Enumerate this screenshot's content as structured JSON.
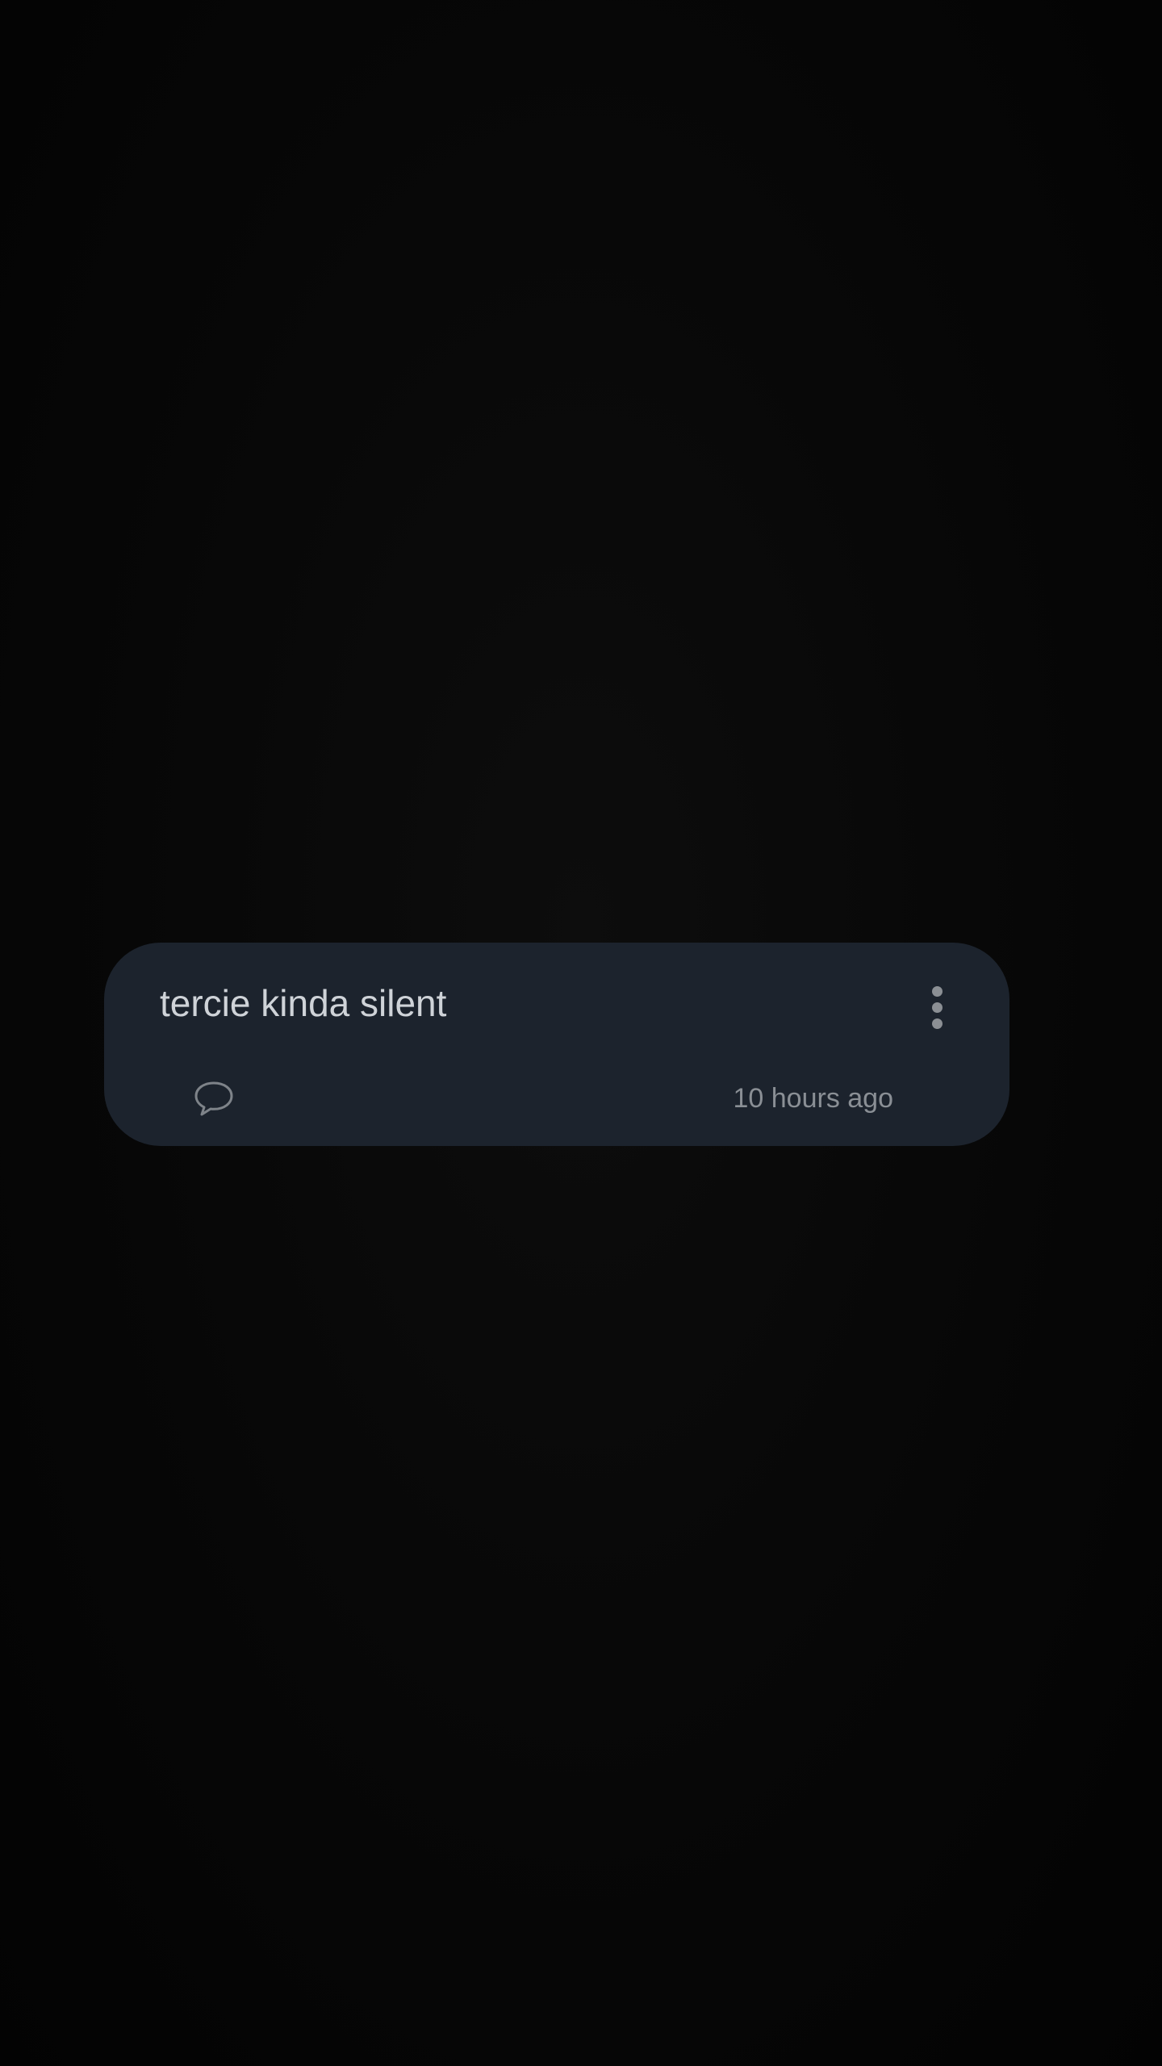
{
  "post": {
    "text": "tercie kinda silent",
    "timestamp": "10 hours ago",
    "icons": {
      "comment": "speech-bubble-icon",
      "more": "more-vertical-icon"
    }
  },
  "colors": {
    "background": "#050505",
    "card": "#1c232d",
    "text": "#cfd3d8",
    "muted": "#8a8f95"
  }
}
